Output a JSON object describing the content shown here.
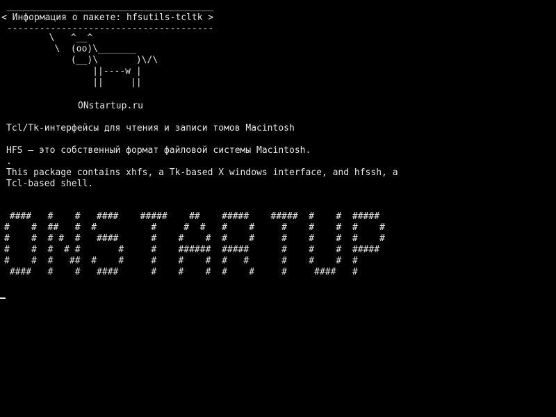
{
  "terminal": {
    "bubble_top": " ______________________________________",
    "bubble_text": "< Информация о пакете: hfsutils-tcltk >",
    "bubble_bottom": " --------------------------------------",
    "cow": [
      "        \\   ^__^",
      "         \\  (oo)\\_______",
      "            (__)\\       )\\/\\",
      "                ||----w |",
      "                ||     ||"
    ],
    "site": "ONstartup.ru",
    "desc_line_1": "Tcl/Tk-интерфейсы для чтения и записи томов Macintosh",
    "desc_line_2": "HFS – это собственный формат файловой системы Macintosh.",
    "desc_dot": ".",
    "desc_line_3": "This package contains xhfs, a Tk-based X windows interface, and hfssh, a",
    "desc_line_4": "Tcl-based shell.",
    "banner": [
      " ####   #    #   ####    #####    ##    #####    #####  #    #  #####",
      "#    #  ##   #  #          #     #  #   #    #     #    #    #  #    #",
      "#    #  # #  #   ####      #    #    #  #    #     #    #    #  #    #",
      "#    #  #  # #       #     #    ######  #####      #    #    #  #####",
      "#    #  #   ##  #    #     #    #    #  #   #      #    #    #  #",
      " ####   #    #   ####      #    #    #  #    #     #     ####   #"
    ]
  }
}
